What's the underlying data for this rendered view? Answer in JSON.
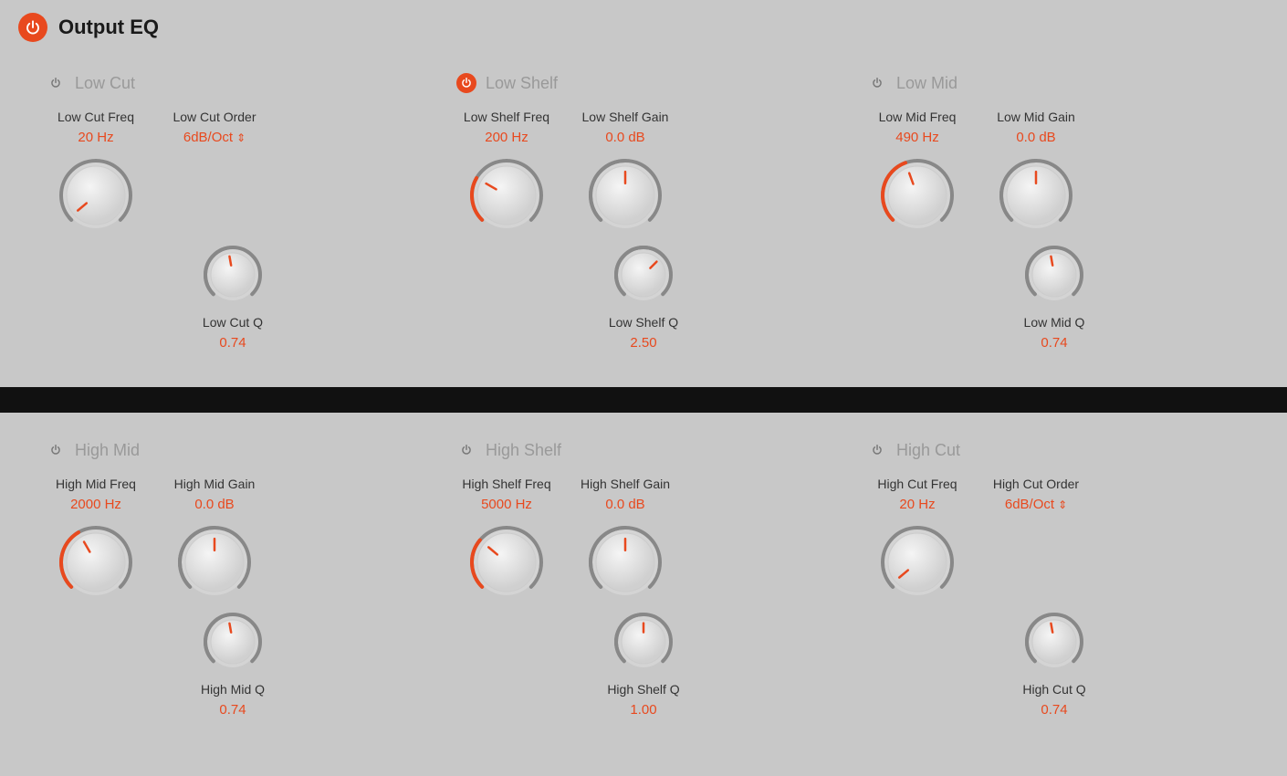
{
  "app": {
    "title": "Output EQ",
    "power_active": true
  },
  "top_bands": [
    {
      "id": "low-cut",
      "name": "Low Cut",
      "active": false,
      "controls": [
        {
          "id": "low-cut-freq",
          "label": "Low Cut Freq",
          "value": "20 Hz",
          "type": "knob",
          "angle": -130,
          "arc_start": -220,
          "arc_end": -130,
          "arc_color": "#888",
          "size": "large"
        },
        {
          "id": "low-cut-order",
          "label": "Low Cut Order",
          "value": "6dB/Oct",
          "type": "dropdown",
          "angle": 0,
          "arc_start": 0,
          "arc_end": 0,
          "arc_color": "#888",
          "size": "none"
        }
      ],
      "q_label": "Low Cut Q",
      "q_value": "0.74",
      "q_angle": -10,
      "q_arc_color": "#888"
    },
    {
      "id": "low-shelf",
      "name": "Low Shelf",
      "active": true,
      "controls": [
        {
          "id": "low-shelf-freq",
          "label": "Low Shelf Freq",
          "value": "200 Hz",
          "type": "knob",
          "angle": -60,
          "arc_color": "#e8491e",
          "size": "large"
        },
        {
          "id": "low-shelf-gain",
          "label": "Low Shelf Gain",
          "value": "0.0 dB",
          "type": "knob",
          "angle": 0,
          "arc_color": "#888",
          "size": "large"
        }
      ],
      "q_label": "Low Shelf Q",
      "q_value": "2.50",
      "q_angle": 45,
      "q_arc_color": "#888"
    },
    {
      "id": "low-mid",
      "name": "Low Mid",
      "active": false,
      "controls": [
        {
          "id": "low-mid-freq",
          "label": "Low Mid Freq",
          "value": "490 Hz",
          "type": "knob",
          "angle": -20,
          "arc_color": "#e8491e",
          "size": "large"
        },
        {
          "id": "low-mid-gain",
          "label": "Low Mid Gain",
          "value": "0.0 dB",
          "type": "knob",
          "angle": 0,
          "arc_color": "#888",
          "size": "large"
        }
      ],
      "q_label": "Low Mid Q",
      "q_value": "0.74",
      "q_angle": -10,
      "q_arc_color": "#888"
    }
  ],
  "bottom_bands": [
    {
      "id": "high-mid",
      "name": "High Mid",
      "active": false,
      "controls": [
        {
          "id": "high-mid-freq",
          "label": "High Mid Freq",
          "value": "2000 Hz",
          "type": "knob",
          "angle": -30,
          "arc_color": "#e8491e",
          "size": "large"
        },
        {
          "id": "high-mid-gain",
          "label": "High Mid Gain",
          "value": "0.0 dB",
          "type": "knob",
          "angle": 0,
          "arc_color": "#888",
          "size": "large"
        }
      ],
      "q_label": "High Mid Q",
      "q_value": "0.74",
      "q_angle": -10,
      "q_arc_color": "#888"
    },
    {
      "id": "high-shelf",
      "name": "High Shelf",
      "active": false,
      "controls": [
        {
          "id": "high-shelf-freq",
          "label": "High Shelf Freq",
          "value": "5000 Hz",
          "type": "knob",
          "angle": -50,
          "arc_color": "#e8491e",
          "size": "large"
        },
        {
          "id": "high-shelf-gain",
          "label": "High Shelf Gain",
          "value": "0.0 dB",
          "type": "knob",
          "angle": 0,
          "arc_color": "#888",
          "size": "large"
        }
      ],
      "q_label": "High Shelf Q",
      "q_value": "1.00",
      "q_angle": 0,
      "q_arc_color": "#888"
    },
    {
      "id": "high-cut",
      "name": "High Cut",
      "active": false,
      "controls": [
        {
          "id": "high-cut-freq",
          "label": "High Cut Freq",
          "value": "20 Hz",
          "type": "knob",
          "angle": -130,
          "arc_color": "#888",
          "size": "large"
        },
        {
          "id": "high-cut-order",
          "label": "High Cut Order",
          "value": "6dB/Oct",
          "type": "dropdown",
          "angle": 0,
          "arc_color": "#888",
          "size": "none"
        }
      ],
      "q_label": "High Cut Q",
      "q_value": "0.74",
      "q_angle": -10,
      "q_arc_color": "#888"
    }
  ]
}
